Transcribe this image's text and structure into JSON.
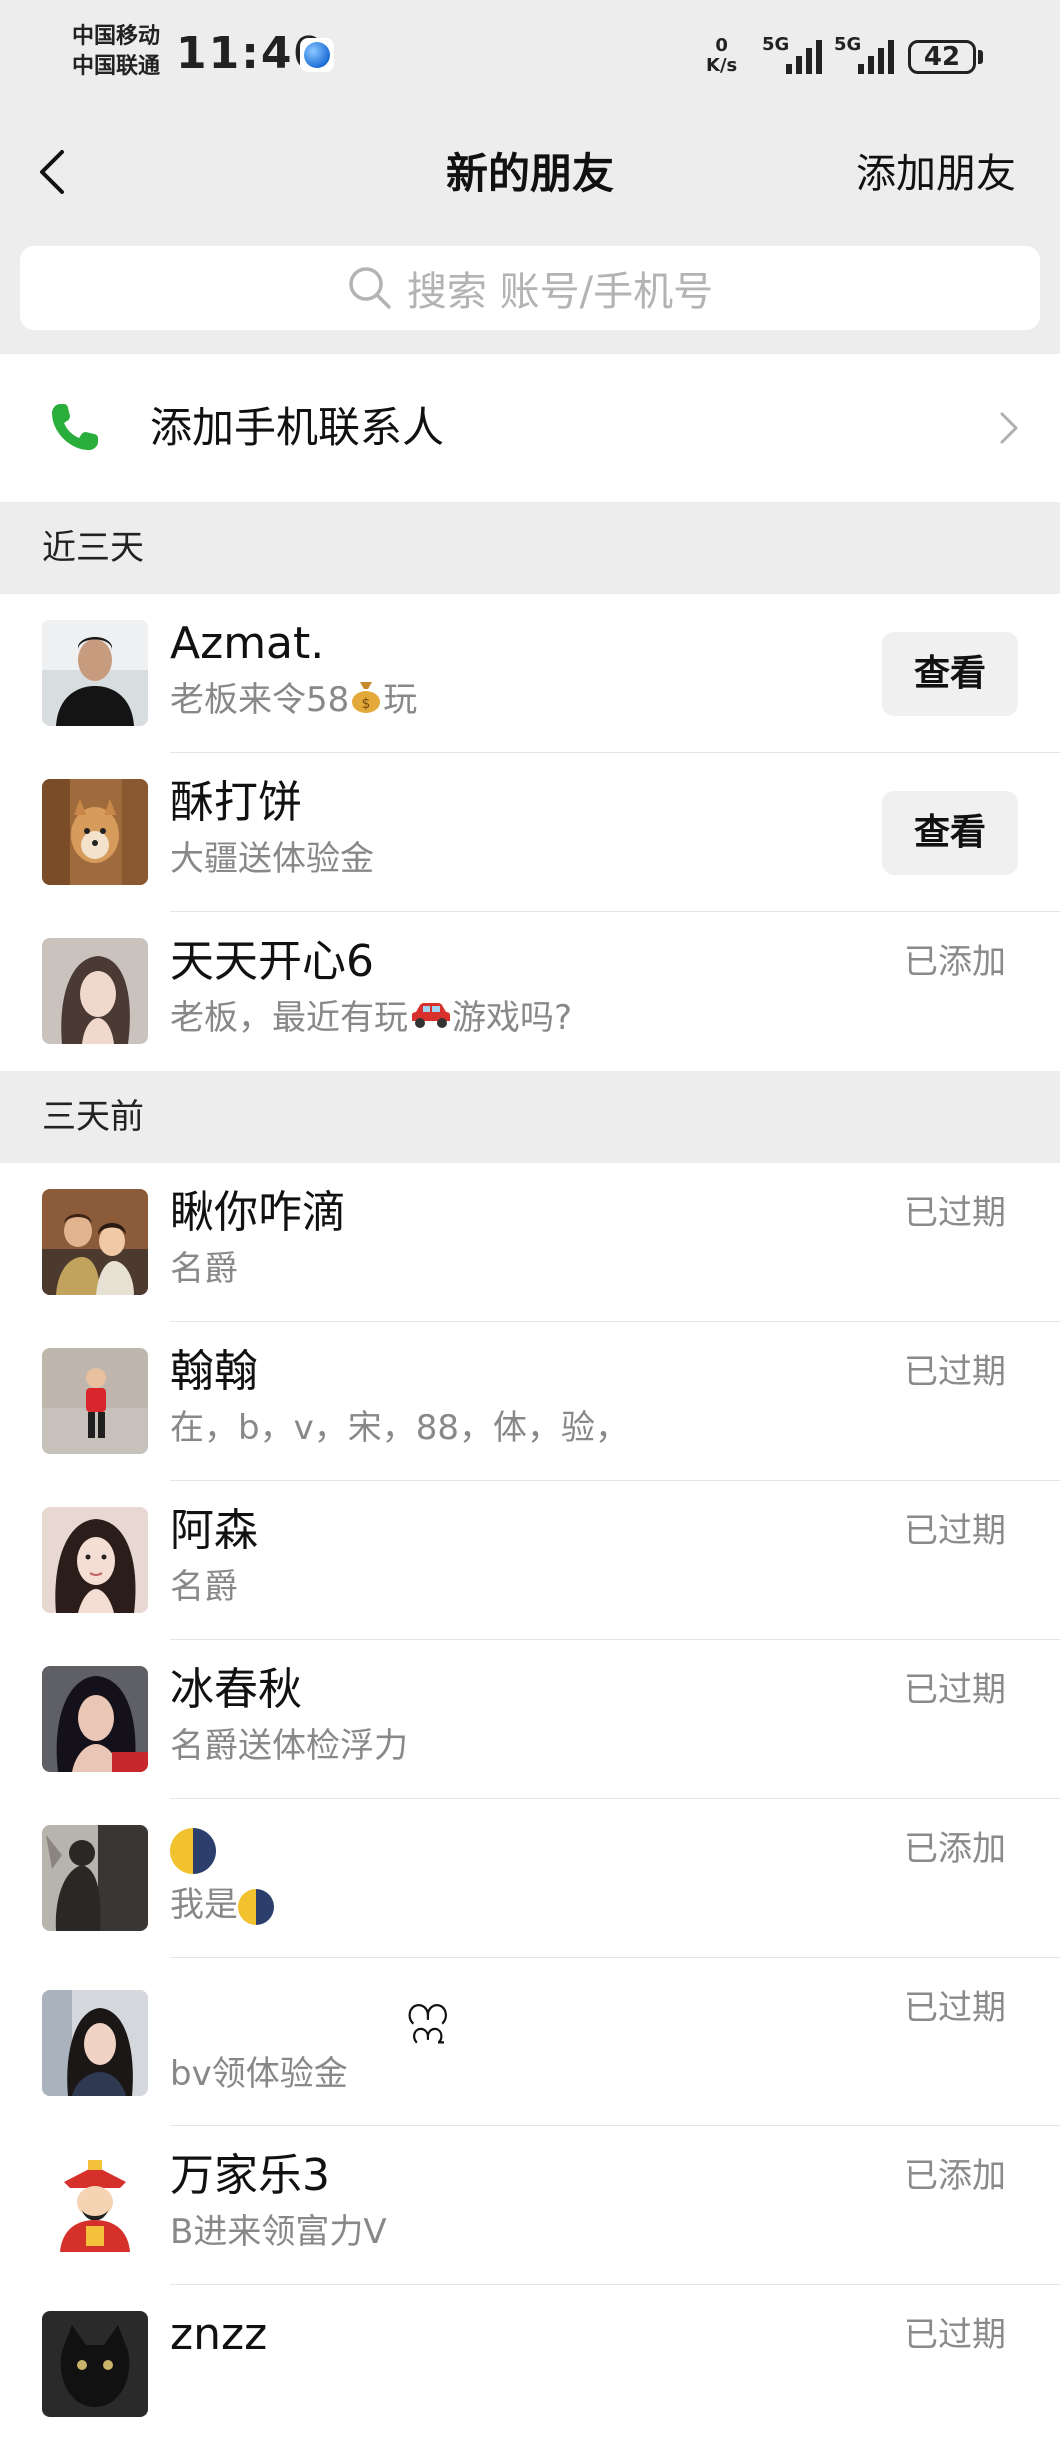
{
  "status_bar": {
    "carrier_1": "中国移动",
    "carrier_2": "中国联通",
    "time": "11:40",
    "net_speed_value": "0",
    "net_speed_unit": "K/s",
    "signal_1": "5G",
    "signal_2": "5G",
    "battery": "42"
  },
  "nav": {
    "title": "新的朋友",
    "add_friend_label": "添加朋友"
  },
  "search": {
    "placeholder": "搜索 账号/手机号"
  },
  "add_contacts": {
    "label": "添加手机联系人"
  },
  "sections": [
    {
      "title": "近三天",
      "items": [
        {
          "name": "Azmat.",
          "message_prefix": "老板来令58",
          "message_suffix": "玩",
          "status": "",
          "action_label": "查看"
        },
        {
          "name": "酥打饼",
          "message_prefix": "大疆送体验金",
          "message_suffix": "",
          "status": "",
          "action_label": "查看"
        },
        {
          "name": "天天开心6",
          "message_prefix": "老板，最近有玩",
          "message_suffix": "游戏吗?",
          "status": "已添加",
          "action_label": ""
        }
      ]
    },
    {
      "title": "三天前",
      "items": [
        {
          "name": "瞅你咋滴",
          "message_prefix": "名爵",
          "message_suffix": "",
          "status": "已过期"
        },
        {
          "name": "翰翰",
          "message_prefix": "在，b，v，宋，88，体，验，",
          "message_suffix": "",
          "status": "已过期"
        },
        {
          "name": "阿森",
          "message_prefix": "名爵",
          "message_suffix": "",
          "status": "已过期"
        },
        {
          "name": "冰春秋",
          "message_prefix": "名爵送体检浮力",
          "message_suffix": "",
          "status": "已过期"
        },
        {
          "name": "",
          "message_prefix": "我是",
          "message_suffix": "",
          "status": "已添加"
        },
        {
          "name": "ဣ",
          "message_prefix": "bv领体验金",
          "message_suffix": "",
          "status": "已过期"
        },
        {
          "name": "万家乐3",
          "message_prefix": "B进来领富力V",
          "message_suffix": "",
          "status": "已添加"
        },
        {
          "name": "znzz",
          "message_prefix": "",
          "message_suffix": "",
          "status": "已过期"
        }
      ]
    }
  ],
  "colors": {
    "background_gray": "#ededed",
    "phone_green": "#2aae3b",
    "secondary_text": "#888888"
  }
}
